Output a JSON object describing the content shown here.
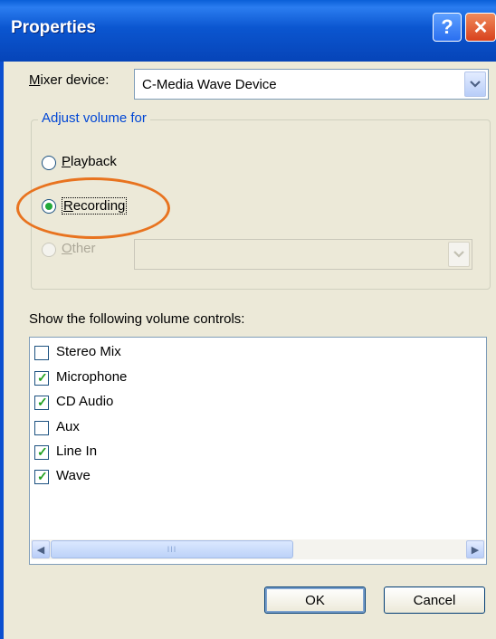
{
  "window": {
    "title": "Properties"
  },
  "titlebar": {
    "help_label": "?",
    "close_label": "✕"
  },
  "mixer": {
    "label": "Mixer device:",
    "value": "C-Media Wave Device"
  },
  "adjust": {
    "group_label": "Adjust volume for",
    "options": [
      {
        "label": "Playback",
        "selected": false,
        "enabled": true
      },
      {
        "label": "Recording",
        "selected": true,
        "enabled": true
      },
      {
        "label": "Other",
        "selected": false,
        "enabled": false
      }
    ],
    "other_value": ""
  },
  "controls": {
    "label": "Show the following volume controls:",
    "items": [
      {
        "label": "Stereo Mix",
        "checked": false
      },
      {
        "label": "Microphone",
        "checked": true
      },
      {
        "label": "CD Audio",
        "checked": true
      },
      {
        "label": "Aux",
        "checked": false
      },
      {
        "label": "Line In",
        "checked": true
      },
      {
        "label": "Wave",
        "checked": true
      }
    ],
    "scroll_left": "◀",
    "scroll_right": "▶",
    "scroll_grip": "III"
  },
  "buttons": {
    "ok": "OK",
    "cancel": "Cancel"
  },
  "colors": {
    "titlebar": "#0b56d0",
    "group_title": "#0046d5",
    "highlight_ellipse": "#e8731f",
    "check": "#21a121"
  },
  "icons": {
    "help": "help-icon",
    "close": "close-icon",
    "dropdown": "chevron-down-icon",
    "check": "check-icon"
  }
}
